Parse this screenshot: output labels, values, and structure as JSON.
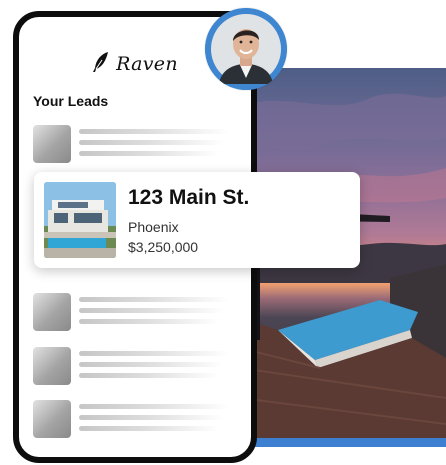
{
  "app": {
    "brand_name": "Raven",
    "brand_icon": "feather-icon"
  },
  "leads_section": {
    "title": "Your Leads"
  },
  "featured_lead": {
    "address": "123 Main St.",
    "city": "Phoenix",
    "price": "$3,250,000"
  },
  "placeholder_leads": [
    {
      "id": 1
    },
    {
      "id": 2
    },
    {
      "id": 3
    },
    {
      "id": 4
    }
  ],
  "colors": {
    "accent": "#3e86cf",
    "frame": "#0d0d0d"
  }
}
